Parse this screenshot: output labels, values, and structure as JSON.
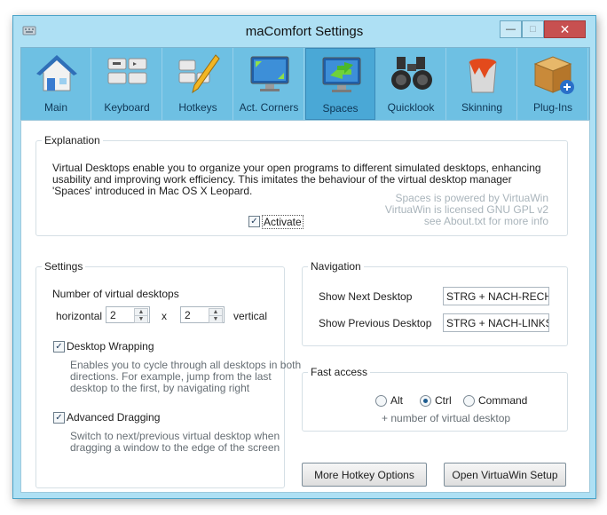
{
  "window": {
    "title": "maComfort Settings",
    "controls": {
      "minimize": "—",
      "maximize": "□",
      "close": "✕"
    }
  },
  "toolbar": [
    {
      "label": "Main",
      "icon": "house-icon"
    },
    {
      "label": "Keyboard",
      "icon": "keyboard-icon"
    },
    {
      "label": "Hotkeys",
      "icon": "hotkeys-pencil-icon"
    },
    {
      "label": "Act. Corners",
      "icon": "monitor-corners-icon"
    },
    {
      "label": "Spaces",
      "icon": "monitor-arrows-icon",
      "active": true
    },
    {
      "label": "Quicklook",
      "icon": "binoculars-icon"
    },
    {
      "label": "Skinning",
      "icon": "paint-bucket-icon"
    },
    {
      "label": "Plug-Ins",
      "icon": "box-plus-icon"
    }
  ],
  "explanation": {
    "legend": "Explanation",
    "text": "Virtual Desktops enable you to organize your open programs to different simulated desktops, enhancing usability and improving work efficiency. This imitates the behaviour of the virtual desktop manager 'Spaces' introduced in Mac OS X Leopard.",
    "activate_label": "Activate",
    "activate_checked": true,
    "credit_1": "Spaces is powered by VirtuaWin",
    "credit_2": "VirtuaWin is licensed GNU GPL v2",
    "credit_3": "see About.txt for more info"
  },
  "settings": {
    "legend": "Settings",
    "num_label": "Number of virtual desktops",
    "horizontal_label": "horizontal",
    "horizontal_value": "2",
    "x_label": "x",
    "vertical_value": "2",
    "vertical_label": "vertical",
    "wrapping_label": "Desktop Wrapping",
    "wrapping_checked": true,
    "wrapping_desc_1": "Enables you to cycle through all desktops in both",
    "wrapping_desc_2": "directions. For example, jump from the last",
    "wrapping_desc_3": "desktop to the first, by navigating right",
    "dragging_label": "Advanced Dragging",
    "dragging_checked": true,
    "dragging_desc_1": "Switch to next/previous virtual desktop when",
    "dragging_desc_2": "dragging a window to the edge of the screen"
  },
  "navigation": {
    "legend": "Navigation",
    "next_label": "Show Next Desktop",
    "next_value": "STRG + NACH-RECHTS",
    "prev_label": "Show Previous Desktop",
    "prev_value": "STRG + NACH-LINKS"
  },
  "fast_access": {
    "legend": "Fast access",
    "options": [
      "Alt",
      "Ctrl",
      "Command"
    ],
    "selected": "Ctrl",
    "note": "+ number of virtual desktop"
  },
  "buttons": {
    "hotkey": "More Hotkey Options",
    "setup": "Open VirtuaWin Setup"
  }
}
